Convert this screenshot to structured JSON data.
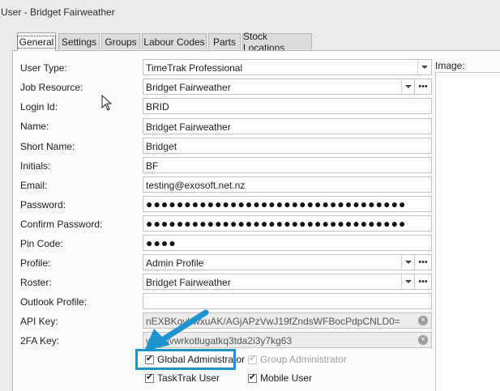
{
  "window": {
    "title": "User - Bridget Fairweather"
  },
  "tabs": [
    {
      "label": "General",
      "active": true
    },
    {
      "label": "Settings",
      "active": false
    },
    {
      "label": "Groups",
      "active": false
    },
    {
      "label": "Labour Codes",
      "active": false
    },
    {
      "label": "Parts",
      "active": false
    },
    {
      "label": "Stock Locations",
      "active": false
    }
  ],
  "form": {
    "user_type": {
      "label": "User Type:",
      "value": "TimeTrak Professional"
    },
    "job_resource": {
      "label": "Job Resource:",
      "value": "Bridget Fairweather"
    },
    "login_id": {
      "label": "Login Id:",
      "value": "BRID"
    },
    "name": {
      "label": "Name:",
      "value": "Bridget Fairweather"
    },
    "short_name": {
      "label": "Short Name:",
      "value": "Bridget"
    },
    "initials": {
      "label": "Initials:",
      "value": "BF"
    },
    "email": {
      "label": "Email:",
      "value": "testing@exosoft.net.nz"
    },
    "password": {
      "label": "Password:",
      "value": "●●●●●●●●●●●●●●●●●●●●●●●●●●●●●●●●●●"
    },
    "confirm_password": {
      "label": "Confirm Password:",
      "value": "●●●●●●●●●●●●●●●●●●●●●●●●●●●●●●●●●●"
    },
    "pin_code": {
      "label": "Pin Code:",
      "value": "●●●●"
    },
    "profile": {
      "label": "Profile:",
      "value": "Admin Profile"
    },
    "roster": {
      "label": "Roster:",
      "value": "Bridget Fairweather"
    },
    "outlook_profile": {
      "label": "Outlook Profile:",
      "value": ""
    },
    "api_key": {
      "label": "API Key:",
      "value": "nEXBKovbwxuAK/AGjAPzVwJ19fZndsWFBocPdpCNLD0="
    },
    "twofa_key": {
      "label": "2FA Key:",
      "value": "wgehvwrkotlugatkq3tda2i3y7kg63"
    }
  },
  "image_panel": {
    "label": "Image:"
  },
  "checkboxes": {
    "global_admin": {
      "label": "Global Administrator",
      "checked": true
    },
    "group_admin": {
      "label": "Group Administrator",
      "checked": true,
      "disabled": true
    },
    "tasktrak_user": {
      "label": "TaskTrak User",
      "checked": true
    },
    "mobile_user": {
      "label": "Mobile User",
      "checked": true
    }
  },
  "icons": {
    "dropdown": "chevron-down-icon",
    "ellipsis": "ellipsis-icon",
    "clear": "clear-icon",
    "check": "✔"
  },
  "colors": {
    "highlight": "#1d94d0",
    "panel_bg": "#fbfbfb",
    "window_bg": "#ebebeb"
  }
}
